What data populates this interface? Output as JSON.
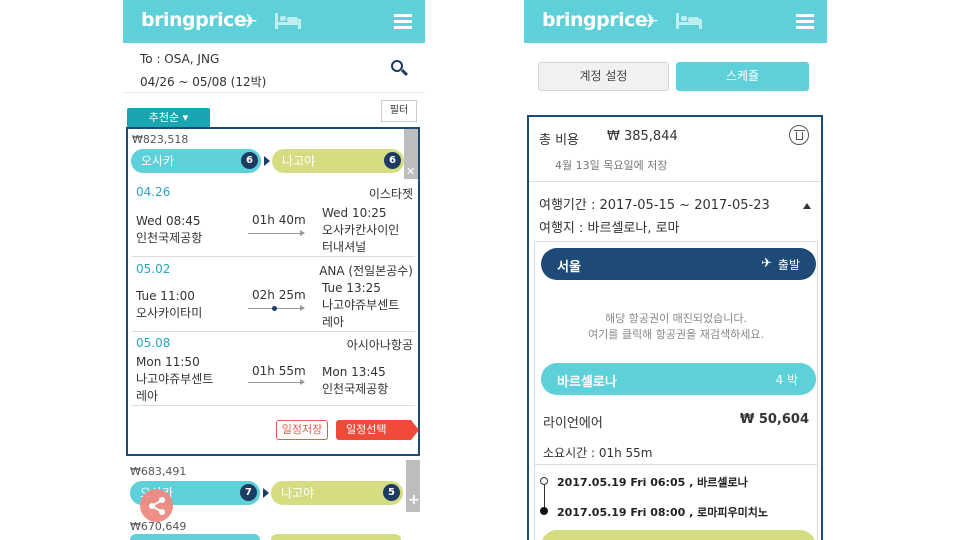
{
  "app": {
    "logo": "bringprice",
    "plane_icon": "plane-icon",
    "bed_icon": "bed-icon",
    "menu_icon": "hamburger-menu-icon"
  },
  "search": {
    "to": "To : OSA, JNG",
    "dates": "04/26 ~ 05/08 (12박)"
  },
  "toolbar": {
    "sort_label": "추천순 ▾",
    "filter_label": "필터"
  },
  "results": [
    {
      "price": "₩823,518",
      "from": "오사카",
      "from_count": "6",
      "to": "나고야",
      "to_count": "6",
      "legs": [
        {
          "date": "04.26",
          "airline": "이스타젯",
          "dep_time": "Wed 08:45",
          "dep_place": "인천국제공항",
          "duration": "01h 40m",
          "arr_time": "Wed 10:25",
          "arr_place1": "오사카칸사이인",
          "arr_place2": "터내셔널"
        },
        {
          "date": "05.02",
          "airline": "ANA (전일본공수)",
          "dep_time": "Tue 11:00",
          "dep_place": "오사카이타미",
          "duration": "02h 25m",
          "arr_time": "Tue 13:25",
          "arr_place1": "나고야쥬부센트",
          "arr_place2": "레아"
        },
        {
          "date": "05.08",
          "airline": "아시아나항공",
          "dep_time": "Mon 11:50",
          "dep_place": "나고야쥬부센트",
          "dep_place2": "레아",
          "duration": "01h 55m",
          "arr_time": "Mon 13:45",
          "arr_place1": "인천국제공항"
        }
      ],
      "save_label": "일정저장",
      "select_label": "일정선택"
    },
    {
      "price": "₩683,491",
      "from": "오사카",
      "from_count": "7",
      "to": "나고야",
      "to_count": "5"
    },
    {
      "price": "₩670,649"
    }
  ],
  "schedule": {
    "tab_account": "계정 설정",
    "tab_schedule": "스케쥴",
    "total_label": "총 비용",
    "total_value": "₩ 385,844",
    "saved_on": "4월 13일 목요일에 저장",
    "period": "여행기간 : 2017-05-15 ~ 2017-05-23",
    "destination": "여행지 : 바르셀로나, 로마",
    "origin_city": "서울",
    "origin_tag": "출발",
    "soldout_1": "해당 항공권이 매진되었습니다.",
    "soldout_2": "여기를 클릭해 항공권을 재검색하세요.",
    "stay_city": "바르셀로나",
    "stay_nights": "4 박",
    "airline": "라이언에어",
    "fare": "₩ 50,604",
    "duration": "소요시간 : 01h 55m",
    "dep_line": "2017.05.19 Fri 06:05 , 바르셀로나",
    "arr_line": "2017.05.19 Fri 08:00 , 로마피우미치노"
  },
  "colors": {
    "primary": "#5dd0d9",
    "navy": "#1d4a77",
    "olive": "#d6dc82",
    "accent_red": "#ef4a3a",
    "link_teal": "#29a7bd"
  }
}
